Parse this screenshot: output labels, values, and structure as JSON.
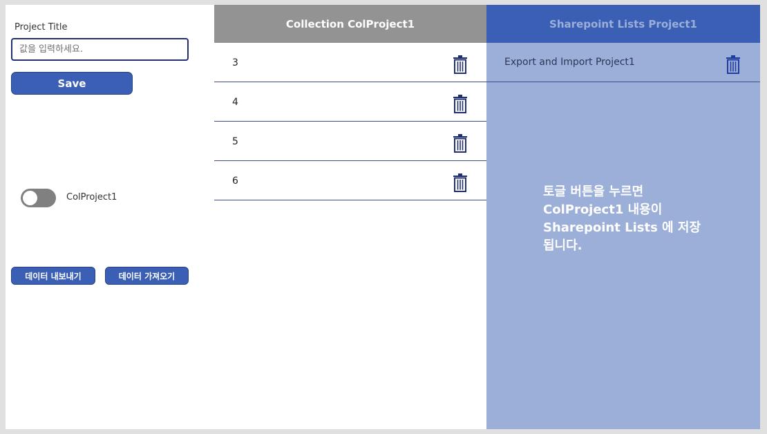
{
  "form": {
    "title_label": "Project Title",
    "title_placeholder": "값을 입력하세요.",
    "title_value": "",
    "save_label": "Save"
  },
  "toggle": {
    "label": "ColProject1",
    "on": false
  },
  "actions": {
    "export_label": "데이터 내보내기",
    "import_label": "데이터 가져오기"
  },
  "collection": {
    "header": "Collection ColProject1",
    "items": [
      {
        "value": "3"
      },
      {
        "value": "4"
      },
      {
        "value": "5"
      },
      {
        "value": "6"
      }
    ]
  },
  "sharepoint": {
    "header": "Sharepoint Lists Project1",
    "items": [
      {
        "value": "Export and Import Project1"
      }
    ],
    "note": "토글 버튼을 누르면 ColProject1 내용이 Sharepoint Lists 에 저장 됩니다."
  },
  "icons": {
    "delete": "trash-icon",
    "toggle_knob": "toggle-knob"
  },
  "colors": {
    "primary": "#3a5fb5",
    "primary_dark": "#1f2e6e",
    "collection_header": "#939393",
    "sharepoint_panel": "#9bafd9",
    "toggle_off": "#808080",
    "background": "#e0e0e0"
  }
}
